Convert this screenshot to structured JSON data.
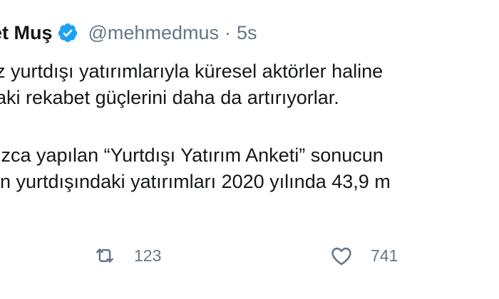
{
  "tweet": {
    "author_name": "et Muş",
    "verified_icon": "verified-badge-icon",
    "handle": "@mehmedmus",
    "separator": "·",
    "timestamp": "5s",
    "lines": [
      "z yurtdışı yatırımlarıyla küresel aktörler haline",
      "aki rekabet güçlerini daha da artırıyorlar.",
      "",
      "ızca yapılan “Yurtdışı Yatırım Anketi” sonucun",
      "in yurtdışındaki yatırımları 2020 yılında 43,9 m"
    ]
  },
  "actions": {
    "retweet": {
      "icon": "retweet-icon",
      "count": "123"
    },
    "like": {
      "icon": "heart-icon",
      "count": "741"
    }
  },
  "colors": {
    "text": "#14171a",
    "secondary": "#657786",
    "verified": "#1da1f2",
    "background": "#ffffff"
  }
}
